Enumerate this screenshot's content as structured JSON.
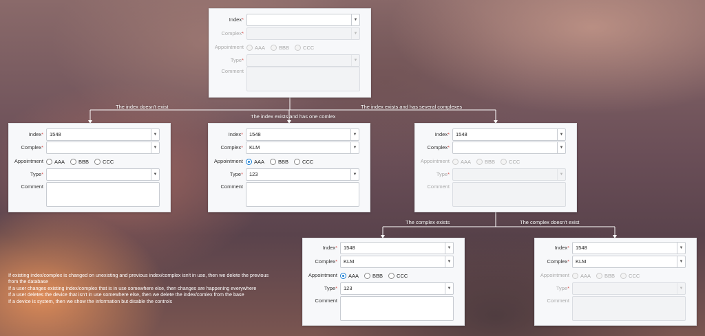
{
  "labels": {
    "index": "Index",
    "complex": "Complex",
    "appointment": "Appointment",
    "type": "Type",
    "comment": "Comment",
    "required_mark": "*"
  },
  "radio_options": [
    "AAA",
    "BBB",
    "CCC"
  ],
  "forms": {
    "top": {
      "index": "",
      "complex": "",
      "appointment": "",
      "type": "",
      "comment": "",
      "enabled": "index only"
    },
    "no_index": {
      "index": "1548",
      "complex": "",
      "appointment": "",
      "type": "",
      "comment": "",
      "enabled": "all"
    },
    "one_complex": {
      "index": "1548",
      "complex": "KLM",
      "appointment": "AAA",
      "type": "123",
      "comment": "",
      "enabled": "all"
    },
    "several_complexes": {
      "index": "1548",
      "complex": "",
      "appointment": "",
      "type": "",
      "comment": "",
      "enabled": "index and complex"
    },
    "complex_exists": {
      "index": "1548",
      "complex": "KLM",
      "appointment": "AAA",
      "type": "123",
      "comment": "",
      "enabled": "all"
    },
    "complex_missing": {
      "index": "1548",
      "complex": "KLM",
      "appointment": "",
      "type": "",
      "comment": "",
      "enabled": "index and complex"
    }
  },
  "connectors": {
    "index_missing": "The index doesn't exist",
    "one_complex": "The index exists and has one comlex",
    "several_complexes": "The index exists and has several complexes",
    "complex_exists": "The complex exists",
    "complex_missing": "The complex doesn't exist"
  },
  "notes": [
    "If existing index/complex is changed on unexisting and previous index/complex isn't in use, then we delete the previous from the database",
    "If a user changes existing index/complex that is in use somewhere else, then changes are happening everywhere",
    "If a user deletes the device that isn't in use somewhere else, then we delete the index/comlex from the base",
    "If a device is system, then we show the information but disable the controls"
  ],
  "colors": {
    "accent": "#1a7fd4",
    "required": "#d9534f",
    "connector": "#ffffff"
  }
}
